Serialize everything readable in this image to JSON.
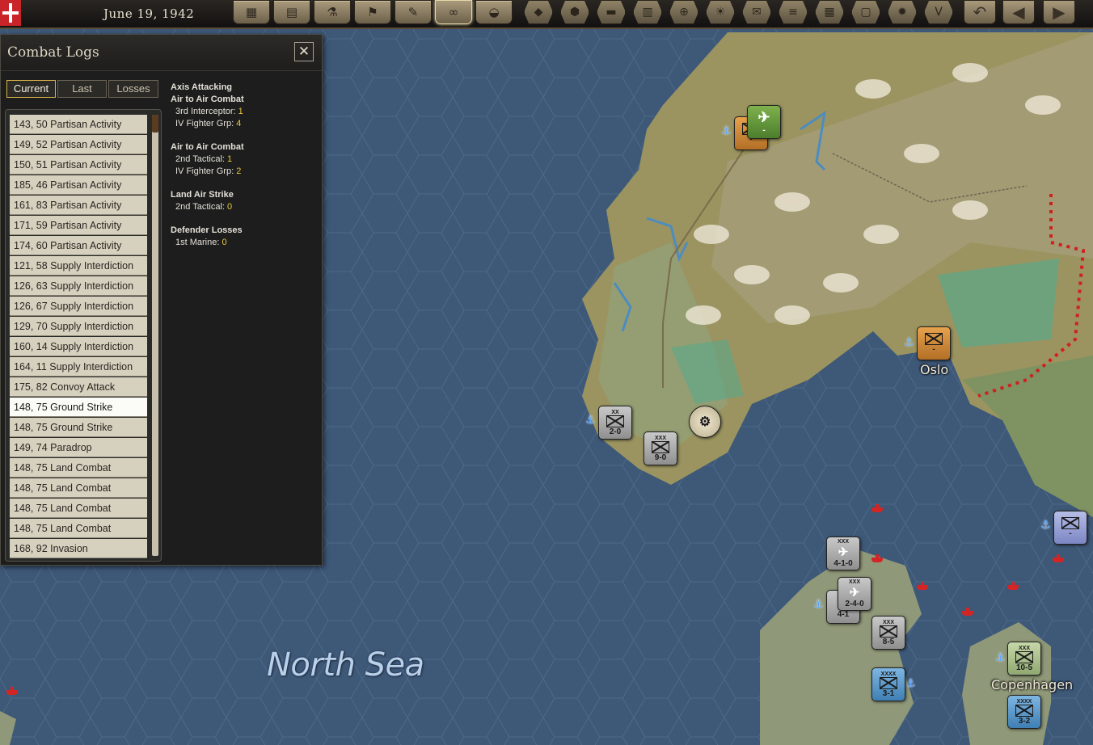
{
  "topbar": {
    "date": "June 19, 1942",
    "buttons": [
      "calendar-icon",
      "bag-icon",
      "research-icon",
      "flag-icon",
      "notes-icon",
      "binoculars-icon",
      "helmet-icon"
    ],
    "right_buttons": [
      "land-unit-icon",
      "naval-icon",
      "rail-icon",
      "supply-icon",
      "target-icon",
      "sun-icon",
      "mail-icon",
      "bridge-icon",
      "grid-icon",
      "map-icon",
      "fire-icon",
      "victory-icon",
      "undo-icon",
      "back-arrow-icon",
      "forward-arrow-icon"
    ]
  },
  "panel": {
    "title": "Combat Logs",
    "tabs": [
      "Current",
      "Last",
      "Losses"
    ],
    "selected_tab": "Current",
    "entries": [
      "143, 50 Partisan Activity",
      "149, 52 Partisan Activity",
      "150, 51 Partisan Activity",
      "185, 46 Partisan Activity",
      "161, 83 Partisan Activity",
      "171, 59 Partisan Activity",
      "174, 60 Partisan Activity",
      "121, 58 Supply Interdiction",
      "126, 63 Supply Interdiction",
      "126, 67 Supply Interdiction",
      "129, 70 Supply Interdiction",
      "160, 14 Supply Interdiction",
      "164, 11 Supply Interdiction",
      "175, 82 Convoy Attack",
      "148, 75 Ground Strike",
      "148, 75 Ground Strike",
      "149, 74 Paradrop",
      "148, 75 Land Combat",
      "148, 75 Land Combat",
      "148, 75 Land Combat",
      "148, 75 Land Combat",
      "168, 92 Invasion"
    ],
    "selected_entry_index": 14,
    "detail": {
      "header": "Axis Attacking",
      "sections": [
        {
          "title": "Air to Air Combat",
          "lines": [
            {
              "label": "3rd Interceptor: ",
              "value": "1"
            },
            {
              "label": "IV Fighter Grp: ",
              "value": "4"
            }
          ]
        },
        {
          "title": "Air to Air Combat",
          "lines": [
            {
              "label": "2nd Tactical: ",
              "value": "1"
            },
            {
              "label": "IV Fighter Grp: ",
              "value": "2"
            }
          ]
        },
        {
          "title": "Land Air Strike",
          "lines": [
            {
              "label": "2nd Tactical: ",
              "value": "0"
            }
          ]
        },
        {
          "title": "Defender Losses",
          "lines": [
            {
              "label": "1st Marine: ",
              "value": "0"
            }
          ]
        }
      ]
    }
  },
  "map": {
    "sea_label": "North Sea",
    "cities": [
      "Oslo",
      "Copenhagen"
    ],
    "units": [
      {
        "name": "unit-orange-north",
        "label": "-",
        "style": "orange"
      },
      {
        "name": "unit-green-aircraft",
        "label": "-",
        "style": "green"
      },
      {
        "name": "unit-oslo",
        "label": "-",
        "style": "orange"
      },
      {
        "name": "unit-gray-west",
        "size": "XX",
        "label": "2-0",
        "style": "gray"
      },
      {
        "name": "unit-gray-south",
        "size": "XXX",
        "label": "9-0",
        "style": "gray"
      },
      {
        "name": "unit-airforce",
        "size": "XXX",
        "label": "4-1-0",
        "style": "gray"
      },
      {
        "name": "unit-bomber",
        "size": "XXX",
        "label": "2-4-0",
        "style": "gray"
      },
      {
        "name": "unit-stack",
        "label": "4-1",
        "style": "gray"
      },
      {
        "name": "unit-infantry-denmark",
        "size": "XXX",
        "label": "8-5",
        "style": "gray"
      },
      {
        "name": "unit-blue-armor",
        "size": "XXXX",
        "label": "3-1",
        "style": "blue"
      },
      {
        "name": "unit-copenhagen",
        "size": "XXX",
        "label": "10-5",
        "style": "lgreen"
      },
      {
        "name": "unit-blue-copenhagen",
        "size": "XXXX",
        "label": "3-2",
        "style": "blue"
      },
      {
        "name": "unit-lblue-east",
        "label": "-",
        "style": "lblue"
      }
    ]
  }
}
